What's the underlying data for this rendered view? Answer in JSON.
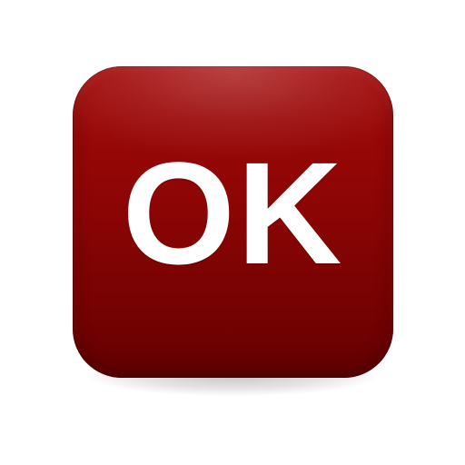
{
  "button": {
    "label": "OK",
    "fill_top_color": "#a30a0a",
    "fill_bottom_color": "#660000",
    "text_color": "#ffffff"
  }
}
